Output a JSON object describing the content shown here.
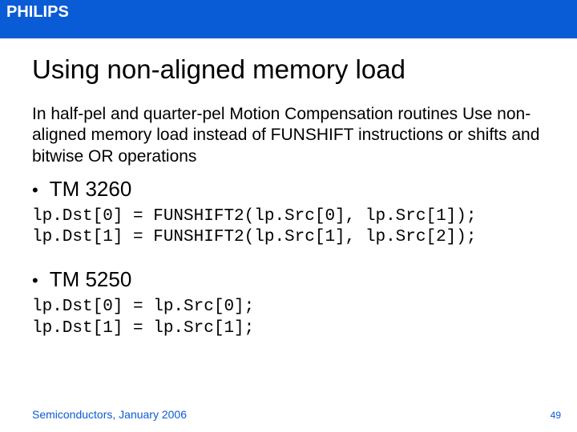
{
  "header": {
    "logo_text": "PHILIPS"
  },
  "slide": {
    "title": "Using non-aligned memory load",
    "paragraph": "In half-pel and quarter-pel Motion Compensation routines Use non-aligned memory load instead of FUNSHIFT instructions or shifts and bitwise OR operations",
    "sections": [
      {
        "bullet": "TM 3260",
        "code": "lp.Dst[0] = FUNSHIFT2(lp.Src[0], lp.Src[1]);\nlp.Dst[1] = FUNSHIFT2(lp.Src[1], lp.Src[2]);"
      },
      {
        "bullet": "TM 5250",
        "code": "lp.Dst[0] = lp.Src[0];\nlp.Dst[1] = lp.Src[1];"
      }
    ]
  },
  "footer": {
    "left": "Semiconductors, January 2006",
    "page": "49"
  }
}
